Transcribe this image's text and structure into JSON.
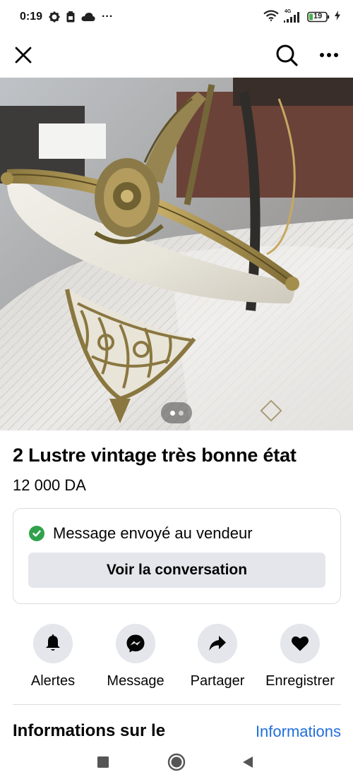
{
  "status_bar": {
    "time": "0:19",
    "dots": "···",
    "network": "4G",
    "battery": "19"
  },
  "top_bar": {
    "close_icon": "close-icon",
    "search_icon": "search-icon",
    "more_icon": "more-icon"
  },
  "listing": {
    "photo_pages": 2,
    "photo_current_page": 1,
    "title": "2 Lustre vintage très bonne état",
    "price": "12 000 DA"
  },
  "message_card": {
    "status_text": "Message envoyé au vendeur",
    "button_label": "Voir la conversation",
    "status_color": "#31a24c"
  },
  "actions": [
    {
      "label": "Alertes",
      "icon": "bell-icon"
    },
    {
      "label": "Message",
      "icon": "messenger-icon"
    },
    {
      "label": "Partager",
      "icon": "share-icon"
    },
    {
      "label": "Enregistrer",
      "icon": "heart-icon"
    }
  ],
  "section": {
    "title": "Informations sur le",
    "link": "Informations",
    "link_color": "#216fdb"
  },
  "nav_bar": {
    "recent_icon": "recent-apps-icon",
    "home_icon": "home-icon",
    "back_icon": "back-icon"
  }
}
